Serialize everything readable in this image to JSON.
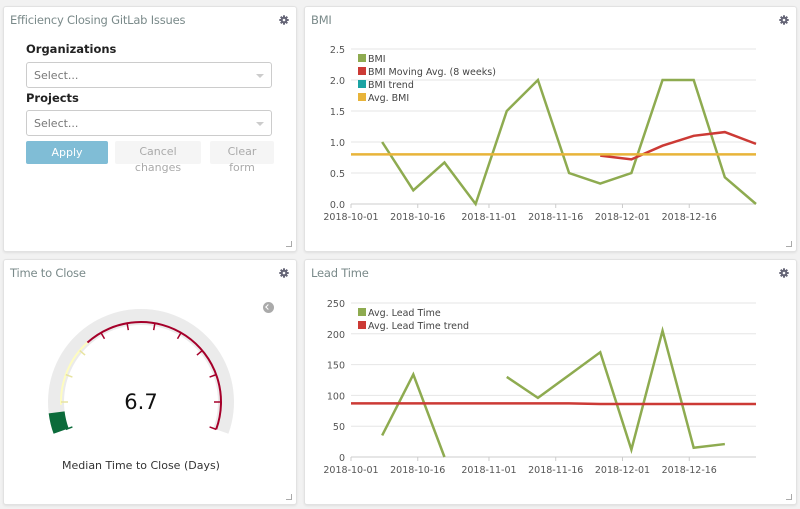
{
  "colors": {
    "bmi": "#8eab50",
    "bmi_moving_avg": "#cc3a35",
    "bmi_trend": "#1ba3a3",
    "avg_bmi": "#e8b43a",
    "lead_time": "#8eab50",
    "lead_time_trend": "#cc3a35",
    "apply_button": "#80bdd6",
    "gauge_green": "#0b6b3a",
    "gauge_yellow": "#fefcc0",
    "gauge_red": "#a5002a",
    "gauge_track": "#ebebeb"
  },
  "filter_panel": {
    "title": "Efficiency Closing GitLab Issues",
    "organizations_label": "Organizations",
    "organizations_placeholder": "Select...",
    "projects_label": "Projects",
    "projects_placeholder": "Select...",
    "apply_label": "Apply",
    "cancel_label_line1": "Cancel",
    "cancel_label_line2": "changes",
    "clear_label_line1": "Clear",
    "clear_label_line2": "form"
  },
  "time_to_close": {
    "title": "Time to Close",
    "value": "6.7",
    "label": "Median Time to Close (Days)"
  },
  "chart_data": [
    {
      "type": "line",
      "title": "BMI",
      "xlabel": "",
      "ylabel": "",
      "ylim": [
        0,
        2.5
      ],
      "yticks": [
        "0.0",
        "0.5",
        "1.0",
        "1.5",
        "2.0",
        "2.5"
      ],
      "xticks": [
        "2018-10-01",
        "2018-10-16",
        "2018-11-01",
        "2018-11-16",
        "2018-12-01",
        "2018-12-16"
      ],
      "grid": true,
      "legend": "top-left",
      "x": [
        "2018-10-08",
        "2018-10-15",
        "2018-10-22",
        "2018-10-29",
        "2018-11-05",
        "2018-11-12",
        "2018-11-19",
        "2018-11-26",
        "2018-12-03",
        "2018-12-10",
        "2018-12-17",
        "2018-12-24",
        "2018-12-31"
      ],
      "series": [
        {
          "name": "BMI",
          "values": [
            1.0,
            0.22,
            0.67,
            0.0,
            1.5,
            2.0,
            0.5,
            0.33,
            0.5,
            2.0,
            2.0,
            0.43,
            0.0
          ]
        },
        {
          "name": "BMI Moving Avg. (8 weeks)",
          "values": [
            null,
            null,
            null,
            null,
            null,
            null,
            null,
            0.78,
            0.72,
            0.94,
            1.1,
            1.16,
            0.97
          ]
        },
        {
          "name": "BMI trend",
          "values": []
        },
        {
          "name": "Avg. BMI",
          "values": [
            0.8,
            0.8,
            0.8,
            0.8,
            0.8,
            0.8,
            0.8,
            0.8,
            0.8,
            0.8,
            0.8,
            0.8,
            0.8
          ]
        }
      ]
    },
    {
      "type": "line",
      "title": "Lead Time",
      "xlabel": "",
      "ylabel": "",
      "ylim": [
        0,
        250
      ],
      "yticks": [
        "0",
        "50",
        "100",
        "150",
        "200",
        "250"
      ],
      "xticks": [
        "2018-10-01",
        "2018-10-16",
        "2018-11-01",
        "2018-11-16",
        "2018-12-01",
        "2018-12-16"
      ],
      "grid": true,
      "legend": "top-left",
      "x": [
        "2018-10-08",
        "2018-10-15",
        "2018-10-22",
        "2018-10-29",
        "2018-11-05",
        "2018-11-12",
        "2018-11-19",
        "2018-11-26",
        "2018-12-03",
        "2018-12-10",
        "2018-12-17",
        "2018-12-24"
      ],
      "series": [
        {
          "name": "Avg. Lead Time",
          "values": [
            35,
            134,
            0,
            null,
            130,
            96,
            133,
            170,
            12,
            205,
            15,
            21
          ]
        },
        {
          "name": "Avg. Lead Time trend",
          "values": [
            87,
            87,
            87,
            87,
            87,
            87,
            87,
            86,
            86,
            86,
            86,
            86
          ]
        }
      ]
    }
  ]
}
